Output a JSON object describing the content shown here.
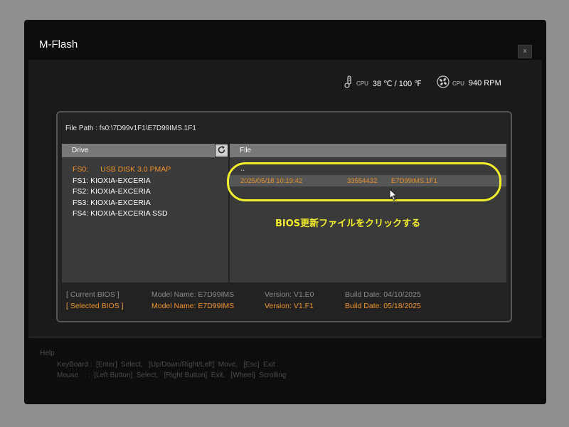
{
  "window": {
    "title": "M-Flash",
    "close_label": "x"
  },
  "status": {
    "cpu_temp_label": "CPU",
    "cpu_temp_value": "38 ℃ / 100 ℉",
    "cpu_fan_label": "CPU",
    "cpu_fan_value": "940 RPM"
  },
  "file_path": "File Path : fs0:\\7D99v1F1\\E7D99IMS.1F1",
  "headers": {
    "drive": "Drive",
    "file": "File"
  },
  "drives": [
    {
      "id": "FS0:",
      "name": "USB DISK 3.0 PMAP",
      "selected": true
    },
    {
      "label": "FS1: KIOXIA-EXCERIA"
    },
    {
      "label": "FS2: KIOXIA-EXCERIA"
    },
    {
      "label": "FS3: KIOXIA-EXCERIA"
    },
    {
      "label": "FS4: KIOXIA-EXCERIA SSD"
    }
  ],
  "files": {
    "parent": "..",
    "items": [
      {
        "date": "2025/05/18 10:19:42",
        "size": "33554432",
        "name": "E7D99IMS.1F1"
      }
    ]
  },
  "annotation": "BIOS更新ファイルをクリックする",
  "bios_info": {
    "current": {
      "label": "[ Current BIOS  ]",
      "model": "Model Name: E7D99IMS",
      "version": "Version: V1.E0",
      "build": "Build Date: 04/10/2025"
    },
    "selected": {
      "label": "[ Selected BIOS ]",
      "model": "Model Name: E7D99IMS",
      "version": "Version: V1.F1",
      "build": "Build Date: 05/18/2025"
    }
  },
  "help": {
    "title": "Help",
    "keyboard": "KeyBoard :  [Enter]  Select,   [Up/Down/Right/Left]  Move,   [Esc]  Exit",
    "mouse": "Mouse     :  [Left Button]  Select,   [Right Button]  Exit,   [Wheel]  Scrolling"
  },
  "colors": {
    "accent": "#f0932b",
    "annotation": "#f3ee2a"
  },
  "icons": {
    "temp": "thermometer-icon",
    "fan": "fan-icon",
    "refresh": "refresh-icon",
    "pointer": "mouse-pointer-icon"
  }
}
